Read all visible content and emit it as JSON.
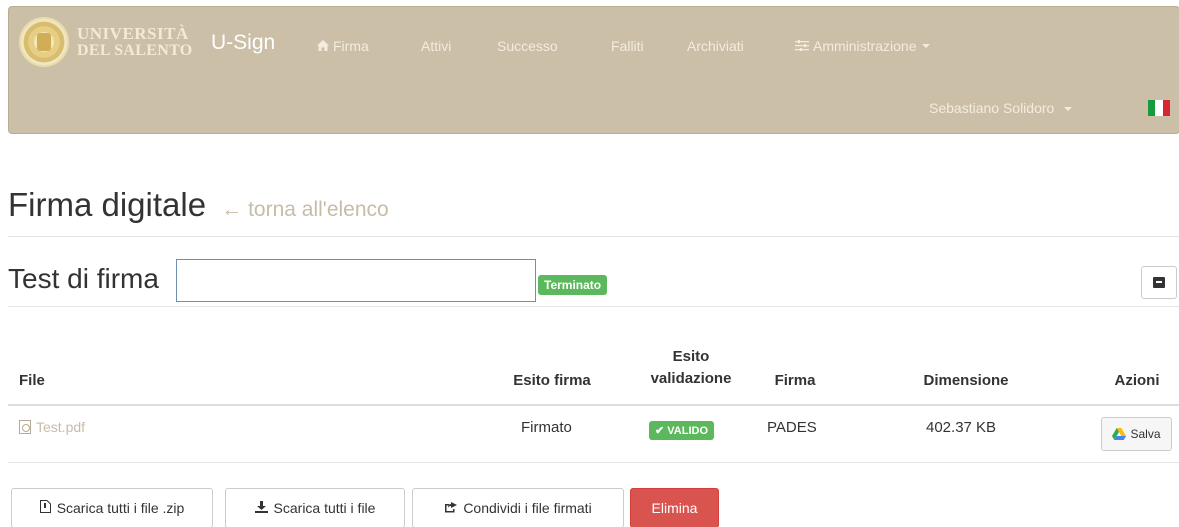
{
  "navbar": {
    "university_line1": "UNIVERSITÀ",
    "university_line2": "DEL SALENTO",
    "app_name": "U-Sign",
    "links": [
      {
        "label": "Firma",
        "icon": "home-icon"
      },
      {
        "label": "Attivi"
      },
      {
        "label": "Successo"
      },
      {
        "label": "Falliti"
      },
      {
        "label": "Archiviati"
      },
      {
        "label": "Amministrazione",
        "icon": "sliders-icon"
      }
    ],
    "user_name": "Sebastiano Solidoro",
    "language_flag": "italy-flag-icon",
    "colors": {
      "background": "#ccbfa7",
      "text": "#f3ecdf"
    }
  },
  "page": {
    "title": "Firma digitale",
    "back_arrow": "←",
    "back_link": "torna all'elenco",
    "subtitle": "Test di firma",
    "title_input_value": "",
    "status_badge": "Terminato",
    "archive_icon": "archive-icon"
  },
  "table": {
    "headers": {
      "file": "File",
      "esito_firma": "Esito firma",
      "esito_validazione_line1": "Esito",
      "esito_validazione_line2": "validazione",
      "firma": "Firma",
      "dimensione": "Dimensione",
      "azioni": "Azioni"
    },
    "rows": [
      {
        "file": "Test.pdf",
        "esito_firma": "Firmato",
        "esito_validazione": "VALIDO",
        "firma": "PADES",
        "dimensione": "402.37 KB",
        "action_label": "Salva"
      }
    ]
  },
  "actions": {
    "download_zip": "Scarica tutti i file .zip",
    "download_all": "Scarica tutti i file",
    "share_signed": "Condividi i file firmati",
    "delete": "Elimina"
  },
  "colors": {
    "success": "#5cb85c",
    "danger": "#d9534f",
    "link_muted": "#c7bca8"
  }
}
